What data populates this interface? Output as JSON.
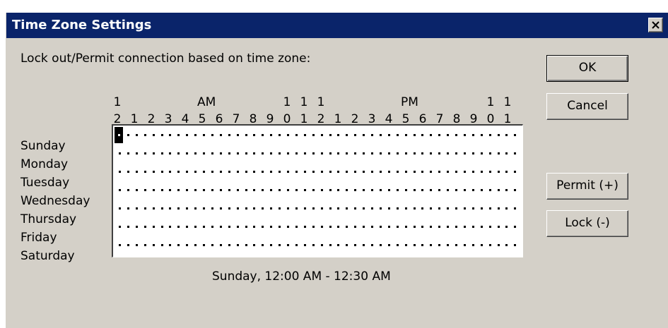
{
  "window": {
    "title": "Time Zone Settings",
    "title_bar_color": "#0a246a",
    "face_color": "#d4d0c8",
    "close_icon": "close-icon"
  },
  "heading": "Lock out/Permit connection based on time zone:",
  "hours": {
    "top_digits": [
      "1",
      "",
      "",
      "",
      "",
      "",
      "",
      "",
      "",
      "1",
      "1",
      "1",
      "",
      "",
      "",
      "",
      "",
      "",
      "",
      "",
      "",
      "1",
      "1"
    ],
    "bottom_digits": [
      "2",
      "1",
      "2",
      "3",
      "4",
      "5",
      "6",
      "7",
      "8",
      "9",
      "0",
      "1",
      "2",
      "1",
      "2",
      "3",
      "4",
      "5",
      "6",
      "7",
      "8",
      "9",
      "0",
      "1"
    ],
    "am_label": "AM",
    "pm_label": "PM"
  },
  "days": [
    "Sunday",
    "Monday",
    "Tuesday",
    "Wednesday",
    "Thursday",
    "Friday",
    "Saturday"
  ],
  "grid": {
    "slots_per_day": 48,
    "selected": {
      "day": "Sunday",
      "slot": 0
    }
  },
  "status": "Sunday, 12:00 AM - 12:30 AM",
  "buttons": {
    "ok": "OK",
    "cancel": "Cancel",
    "permit": "Permit (+)",
    "lock": "Lock (-)"
  }
}
